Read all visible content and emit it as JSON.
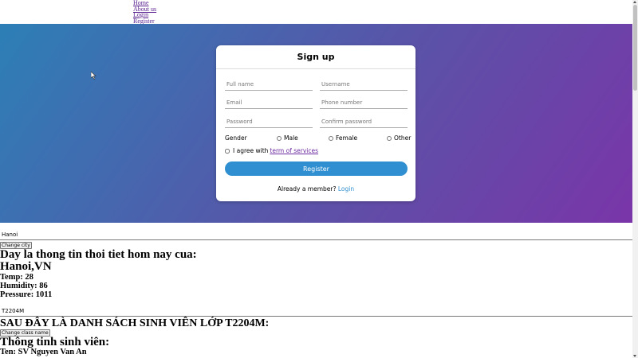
{
  "nav": {
    "links": [
      "Home",
      "About us",
      "Login",
      "Register"
    ]
  },
  "signup": {
    "title": "Sign up",
    "fullname_placeholder": "Full name",
    "username_placeholder": "Username",
    "email_placeholder": "Email",
    "phone_placeholder": "Phone number",
    "password_placeholder": "Password",
    "confirm_placeholder": "Confirm password",
    "gender_label": "Gender",
    "gender_options": [
      "Male",
      "Female",
      "Other"
    ],
    "agree_text": "I agree with",
    "terms_link": "term of services",
    "register_button": "Register",
    "member_text": "Already a member?",
    "login_link": "Login"
  },
  "weather": {
    "city_value": "Hanoi",
    "change_city_button": "Change city",
    "heading": "Day la thong tin thoi tiet hom nay cua:",
    "location": "Hanoi,VN",
    "temp": "Temp: 28",
    "humidity": "Humidity: 86",
    "pressure": "Pressure: 1011"
  },
  "students": {
    "class_value": "T2204M",
    "heading": "SAU ĐÂY LÀ DANH SÁCH SINH VIÊN LỚP T2204M:",
    "change_class_button": "Change class name",
    "info_heading": "Thông tinh sinh viên:",
    "name_line": "Ten: SV Nguyen Van An"
  },
  "colors": {
    "gradient_start": "#2d7fb6",
    "gradient_end": "#7a35a8",
    "button": "#2f8fd0",
    "link": "#6c2aa0"
  }
}
